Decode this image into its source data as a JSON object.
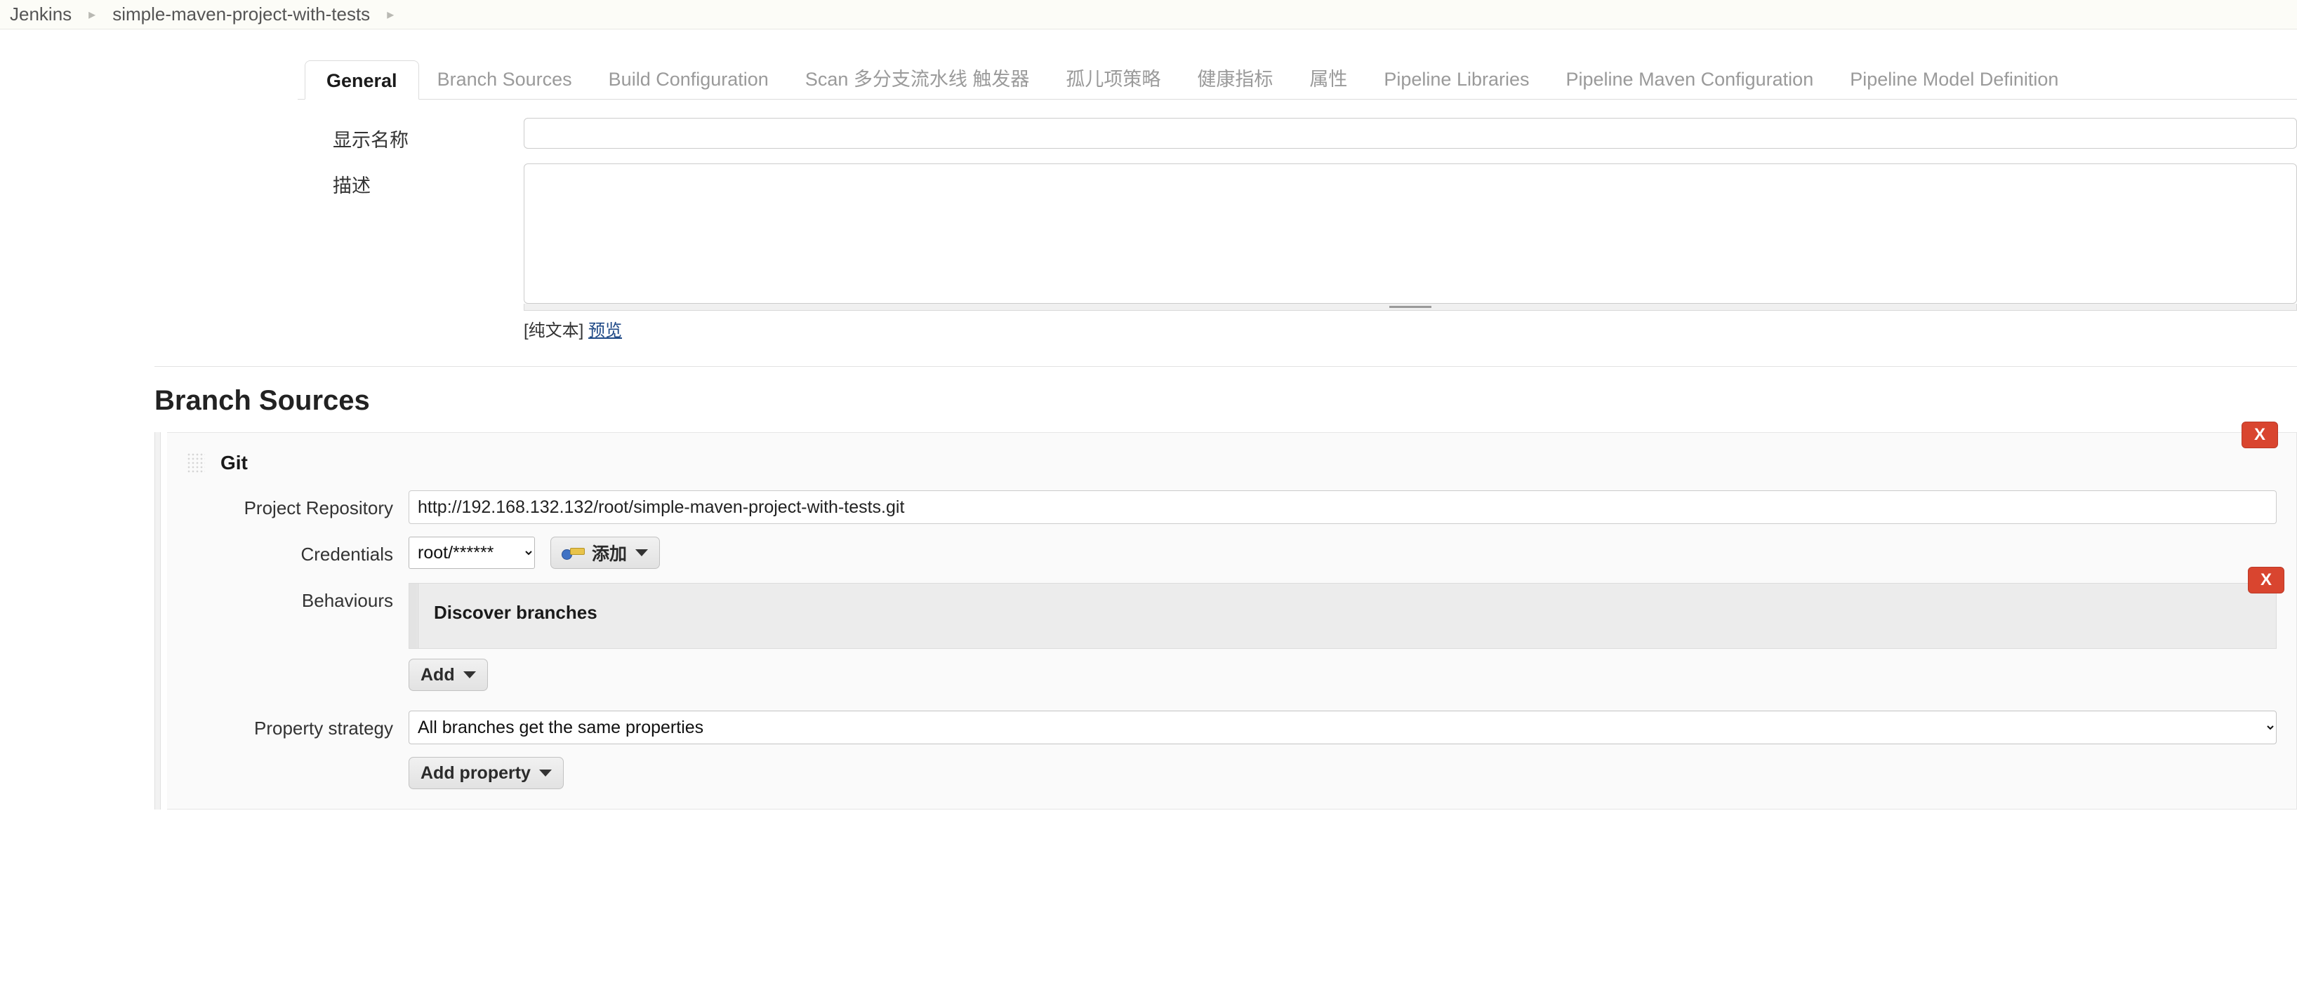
{
  "breadcrumb": {
    "items": [
      {
        "label": "Jenkins"
      },
      {
        "label": "simple-maven-project-with-tests"
      }
    ],
    "separator": "▸"
  },
  "tabs": [
    {
      "label": "General",
      "active": true
    },
    {
      "label": "Branch Sources",
      "active": false
    },
    {
      "label": "Build Configuration",
      "active": false
    },
    {
      "label": "Scan 多分支流水线 触发器",
      "active": false
    },
    {
      "label": "孤儿项策略",
      "active": false
    },
    {
      "label": "健康指标",
      "active": false
    },
    {
      "label": "属性",
      "active": false
    },
    {
      "label": "Pipeline Libraries",
      "active": false
    },
    {
      "label": "Pipeline Maven Configuration",
      "active": false
    },
    {
      "label": "Pipeline Model Definition",
      "active": false
    }
  ],
  "general": {
    "display_name": {
      "label": "显示名称",
      "value": "",
      "placeholder": ""
    },
    "description": {
      "label": "描述",
      "value": "",
      "placeholder": "",
      "footer_plain": "[纯文本]",
      "footer_preview": "预览"
    }
  },
  "branch_sources": {
    "title": "Branch Sources",
    "source": {
      "title": "Git",
      "remove_label": "X",
      "project_repository": {
        "label": "Project Repository",
        "value": "http://192.168.132.132/root/simple-maven-project-with-tests.git"
      },
      "credentials": {
        "label": "Credentials",
        "selected": "root/******",
        "options": [
          "root/******"
        ],
        "add_button": "添加"
      },
      "behaviours": {
        "label": "Behaviours",
        "items": [
          {
            "name": "Discover branches",
            "remove_label": "X"
          }
        ],
        "add_button": "Add"
      },
      "property_strategy": {
        "label": "Property strategy",
        "selected": "All branches get the same properties",
        "options": [
          "All branches get the same properties"
        ],
        "add_button": "Add property"
      }
    }
  },
  "icons": {
    "help": "help-icon",
    "caret": "chevron-down-icon",
    "key": "key-icon",
    "grip": "drag-grip-icon"
  },
  "colors": {
    "danger": "#d9452f",
    "link": "#204a87",
    "tab_inactive": "#9a9a9a",
    "breadcrumb_bg": "#fcfcf7"
  }
}
